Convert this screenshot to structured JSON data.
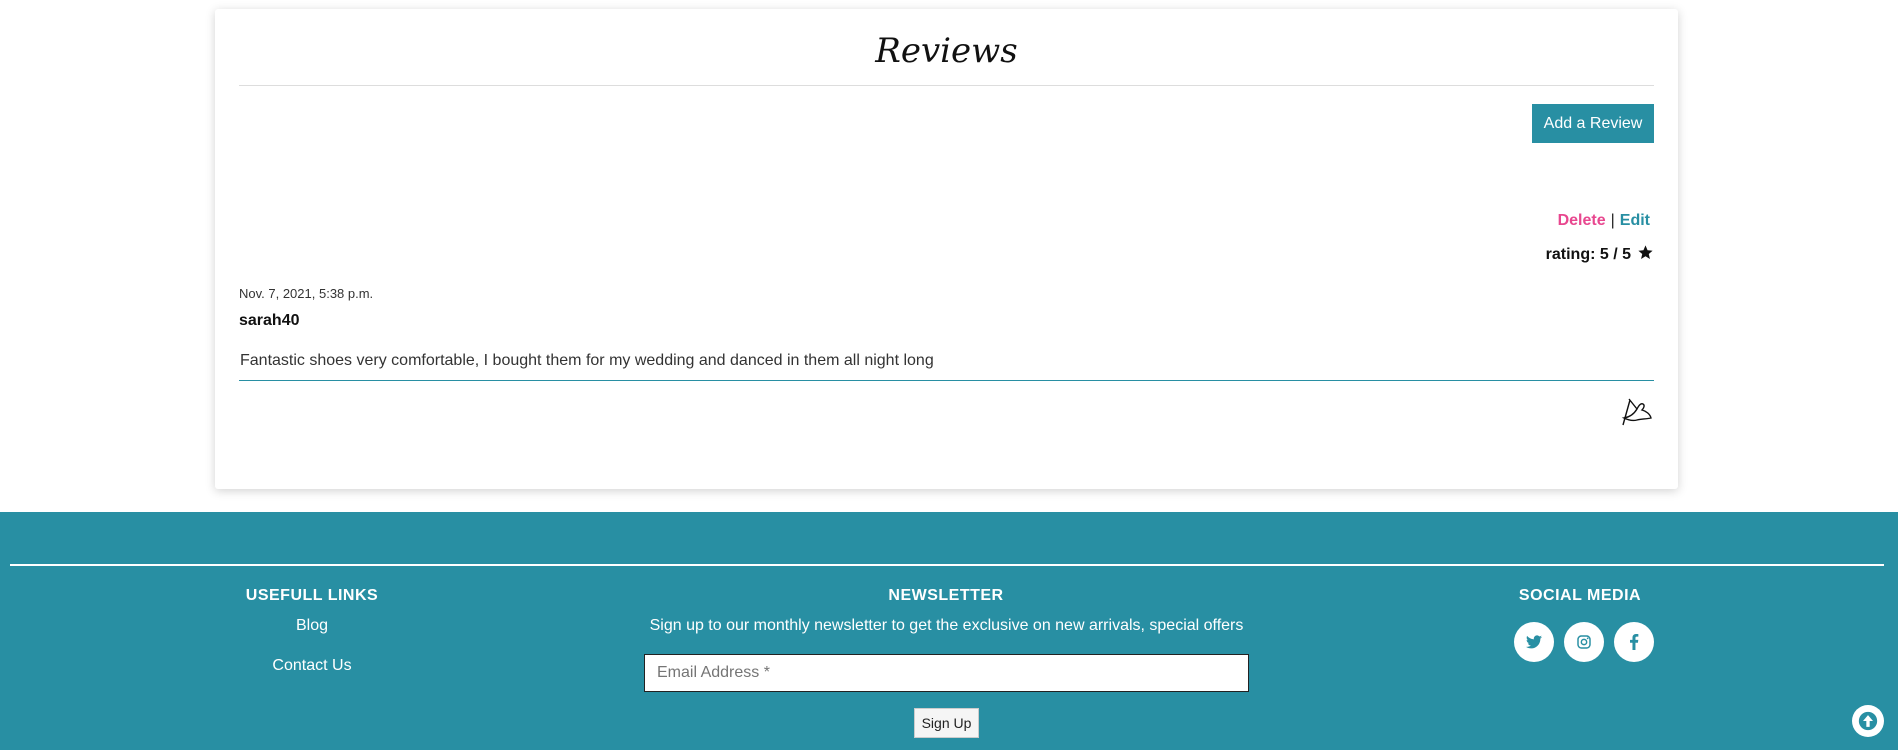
{
  "reviews": {
    "title": "Reviews",
    "add_button": "Add a Review",
    "delete_label": "Delete",
    "separator": "|",
    "edit_label": "Edit",
    "rating_text": "rating: 5 / 5",
    "date": "Nov. 7, 2021, 5:38 p.m.",
    "username": "sarah40",
    "body": "Fantastic shoes very comfortable, I bought them for my wedding and danced in them all night long"
  },
  "footer": {
    "links_heading": "USEFULL LINKS",
    "links": [
      "Blog",
      "Contact Us"
    ],
    "newsletter_heading": "NEWSLETTER",
    "newsletter_text": "Sign up to our monthly newsletter to get the exclusive on new arrivals, special offers",
    "email_placeholder": "Email Address *",
    "signup_label": "Sign Up",
    "social_heading": "SOCIAL MEDIA",
    "social_icons": [
      "twitter-icon",
      "instagram-icon",
      "facebook-icon"
    ]
  },
  "colors": {
    "accent": "#288fa3",
    "delete": "#e8478f"
  }
}
